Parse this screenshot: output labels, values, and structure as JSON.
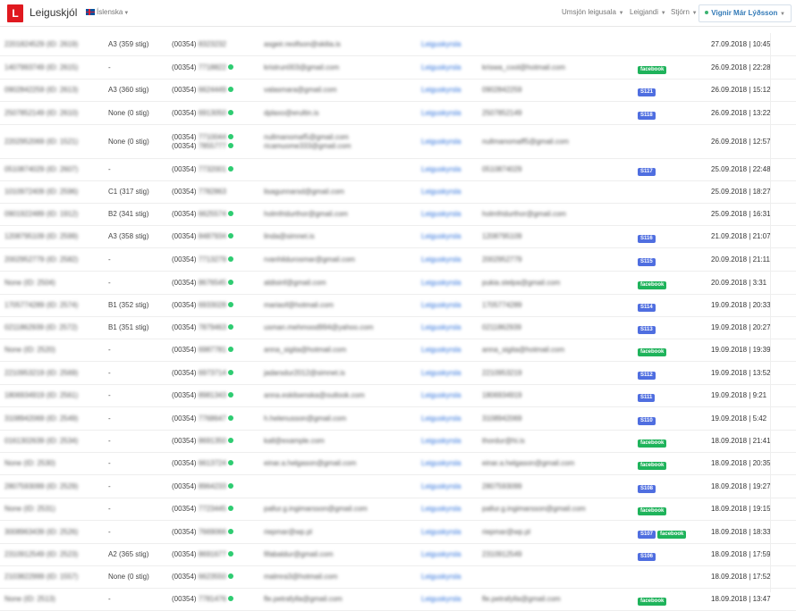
{
  "navbar": {
    "logo_letter": "L",
    "brand": "Leiguskjól",
    "language": "Íslenska",
    "menu": [
      "Umsjón leigusala",
      "Leigjandi",
      "Stjórn"
    ],
    "user": "Vignir Már Lýðsson"
  },
  "table": {
    "rows": [
      {
        "id": "2201824529 (ID: 2619)",
        "score": "A3 (359 stig)",
        "phone_prefix": "(00354)",
        "phone": "8323232",
        "verified": false,
        "email": "asgeir.reolfson@skilia.is",
        "link": "Leiguskyrsla",
        "extra": "",
        "badges": [],
        "date": "27.09.2018 | 10:45",
        "h": 25
      },
      {
        "id": "1407993749 (ID: 2615)",
        "score": "-",
        "phone_prefix": "(00354)",
        "phone": "7718822",
        "verified": true,
        "email": "kristrun003@gmail.com",
        "link": "Leiguskyrsla",
        "extra": "kriswa_cool@hotmail.com",
        "badges": [
          "facebook"
        ],
        "date": "26.09.2018 | 22:28",
        "h": 25
      },
      {
        "id": "0902842259 (ID: 2613)",
        "score": "A3 (360 stig)",
        "phone_prefix": "(00354)",
        "phone": "6624449",
        "verified": true,
        "email": "valasmara@gmail.com",
        "link": "Leiguskyrsla",
        "extra": "0902842259",
        "badges": [
          "S121"
        ],
        "date": "26.09.2018 | 15:12",
        "h": 24
      },
      {
        "id": "2507852149 (ID: 2610)",
        "score": "None (0 stig)",
        "phone_prefix": "(00354)",
        "phone": "6913050",
        "verified": true,
        "email": "dplaxo@erultin.is",
        "link": "Leiguskyrsla",
        "extra": "2507852149",
        "badges": [
          "S118"
        ],
        "date": "26.09.2018 | 13:22",
        "h": 25
      },
      {
        "id": "2202952069 (ID: 1521)",
        "score": "None (0 stig)",
        "phone_prefix": "(00354)",
        "phone": "7710044",
        "phone2": "7855777",
        "verified": true,
        "email": "nullmanomaf5@gmail.com",
        "email2": "ricamuome333@gmail.com",
        "link": "Leiguskyrsla",
        "extra": "nullmanomaff5@gmail.com",
        "badges": [],
        "date": "26.09.2018 | 12:57",
        "h": 37
      },
      {
        "id": "0510874029 (ID: 2607)",
        "score": "-",
        "phone_prefix": "(00354)",
        "phone": "7732001",
        "verified": true,
        "email": "",
        "link": "Leiguskyrsla",
        "extra": "0510874029",
        "badges": [
          "S117"
        ],
        "date": "25.09.2018 | 22:48",
        "h": 24
      },
      {
        "id": "1010972409 (ID: 2596)",
        "score": "C1 (317 stig)",
        "phone_prefix": "(00354)",
        "phone": "7782863",
        "verified": false,
        "email": "lisagunnarsd@gmail.com",
        "link": "Leiguskyrsla",
        "extra": "",
        "badges": [],
        "date": "25.09.2018 | 18:27",
        "h": 24
      },
      {
        "id": "0901922489 (ID: 1912)",
        "score": "B2 (341 stig)",
        "phone_prefix": "(00354)",
        "phone": "6625574",
        "verified": true,
        "email": "holmfridurthor@gmail.com",
        "link": "Leiguskyrsla",
        "extra": "holmfridurthor@gmail.com",
        "badges": [],
        "date": "25.09.2018 | 16:31",
        "h": 24
      },
      {
        "id": "1208795109 (ID: 2599)",
        "score": "A3 (358 stig)",
        "phone_prefix": "(00354)",
        "phone": "8487934",
        "verified": true,
        "email": "linda@simnet.is",
        "link": "Leiguskyrsla",
        "extra": "1208795109",
        "badges": [
          "S116"
        ],
        "date": "21.09.2018 | 21:07",
        "h": 24
      },
      {
        "id": "2002952779 (ID: 2582)",
        "score": "-",
        "phone_prefix": "(00354)",
        "phone": "7713279",
        "verified": true,
        "email": "rvanhildurosmar@gmail.com",
        "link": "Leiguskyrsla",
        "extra": "2002952779",
        "badges": [
          "S115"
        ],
        "date": "20.09.2018 | 21:11",
        "h": 25
      },
      {
        "id": "None (ID: 2504)",
        "score": "-",
        "phone_prefix": "(00354)",
        "phone": "8676545",
        "verified": true,
        "email": "aldisinf@gmail.com",
        "link": "Leiguskyrsla",
        "extra": "pukia.stelpa@gmail.com",
        "badges": [
          "facebook"
        ],
        "date": "20.09.2018 | 3:31",
        "h": 25
      },
      {
        "id": "1705774289 (ID: 2574)",
        "score": "B1 (352 stig)",
        "phone_prefix": "(00354)",
        "phone": "6933028",
        "verified": true,
        "email": "mariaof@hotmail.com",
        "link": "Leiguskyrsla",
        "extra": "1705774289",
        "badges": [
          "S114"
        ],
        "date": "19.09.2018 | 20:33",
        "h": 24
      },
      {
        "id": "0211862939 (ID: 2572)",
        "score": "B1 (351 stig)",
        "phone_prefix": "(00354)",
        "phone": "7879463",
        "verified": true,
        "email": "usman.mehmood994@yahoo.com",
        "link": "Leiguskyrsla",
        "extra": "0211862939",
        "badges": [
          "S113"
        ],
        "date": "19.09.2018 | 20:27",
        "h": 24
      },
      {
        "id": "None (ID: 2520)",
        "score": "-",
        "phone_prefix": "(00354)",
        "phone": "6987781",
        "verified": true,
        "email": "anna_sigita@hotmail.com",
        "link": "Leiguskyrsla",
        "extra": "anna_sigita@hotmail.com",
        "badges": [
          "facebook"
        ],
        "date": "19.09.2018 | 19:39",
        "h": 24
      },
      {
        "id": "2210953219 (ID: 2569)",
        "score": "-",
        "phone_prefix": "(00354)",
        "phone": "6973714",
        "verified": true,
        "email": "jadarsdur2012@simnet.is",
        "link": "Leiguskyrsla",
        "extra": "2210953219",
        "badges": [
          "S112"
        ],
        "date": "19.09.2018 | 13:52",
        "h": 25
      },
      {
        "id": "1806934919 (ID: 2561)",
        "score": "-",
        "phone_prefix": "(00354)",
        "phone": "8981343",
        "verified": true,
        "email": "anna.eskilsenska@outlook.com",
        "link": "Leiguskyrsla",
        "extra": "1806934919",
        "badges": [
          "S111"
        ],
        "date": "19.09.2018 | 9:21",
        "h": 24
      },
      {
        "id": "3108942069 (ID: 2549)",
        "score": "-",
        "phone_prefix": "(00354)",
        "phone": "7768647",
        "verified": true,
        "email": "h.helenusson@gmail.com",
        "link": "Leiguskyrsla",
        "extra": "3108942069",
        "badges": [
          "S110"
        ],
        "date": "19.09.2018 | 5:42",
        "h": 25
      },
      {
        "id": "0161302639 (ID: 2534)",
        "score": "-",
        "phone_prefix": "(00354)",
        "phone": "8691350",
        "verified": true,
        "email": "kall@example.com",
        "link": "Leiguskyrsla",
        "extra": "thordur@hi.is",
        "badges": [
          "facebook"
        ],
        "date": "18.09.2018 | 21:41",
        "h": 24
      },
      {
        "id": "None (ID: 2530)",
        "score": "-",
        "phone_prefix": "(00354)",
        "phone": "6613724",
        "verified": true,
        "email": "einar.a.helgason@gmail.com",
        "link": "Leiguskyrsla",
        "extra": "einar.a.helgason@gmail.com",
        "badges": [
          "facebook"
        ],
        "date": "18.09.2018 | 20:35",
        "h": 24
      },
      {
        "id": "2807593099 (ID: 2529)",
        "score": "-",
        "phone_prefix": "(00354)",
        "phone": "8964233",
        "verified": true,
        "email": "",
        "link": "Leiguskyrsla",
        "extra": "2807593099",
        "badges": [
          "S108"
        ],
        "date": "18.09.2018 | 19:27",
        "h": 25
      },
      {
        "id": "None (ID: 2531)",
        "score": "-",
        "phone_prefix": "(00354)",
        "phone": "7723445",
        "verified": true,
        "email": "pallur.g.ingimarsson@gmail.com",
        "link": "Leiguskyrsla",
        "extra": "pallur.g.ingimarsson@gmail.com",
        "badges": [
          "facebook"
        ],
        "date": "18.09.2018 | 19:15",
        "h": 24
      },
      {
        "id": "3008963439 (ID: 2526)",
        "score": "-",
        "phone_prefix": "(00354)",
        "phone": "7669066",
        "verified": true,
        "email": "riepmar@wp.pl",
        "link": "Leiguskyrsla",
        "extra": "riepmar@wp.pl",
        "badges": [
          "S107",
          "facebook"
        ],
        "date": "18.09.2018 | 18:33",
        "h": 25
      },
      {
        "id": "2310912549 (ID: 2523)",
        "score": "A2 (365 stig)",
        "phone_prefix": "(00354)",
        "phone": "8691677",
        "verified": true,
        "email": "fifabaldur@gmail.com",
        "link": "Leiguskyrsla",
        "extra": "2310912549",
        "badges": [
          "S106"
        ],
        "date": "18.09.2018 | 17:59",
        "h": 24
      },
      {
        "id": "2103822999 (ID: 1557)",
        "score": "None (0 stig)",
        "phone_prefix": "(00354)",
        "phone": "6623550",
        "verified": true,
        "email": "malmra3@hotmail.com",
        "link": "Leiguskyrsla",
        "extra": "",
        "badges": [],
        "date": "18.09.2018 | 17:52",
        "h": 24
      },
      {
        "id": "None (ID: 2513)",
        "score": "-",
        "phone_prefix": "(00354)",
        "phone": "7781476",
        "verified": true,
        "email": "fle.petrafylla@gmail.com",
        "link": "Leiguskyrsla",
        "extra": "fle.petrafylla@gmail.com",
        "badges": [
          "facebook"
        ],
        "date": "18.09.2018 | 13:47",
        "h": 24
      }
    ]
  },
  "colors": {
    "logo_red": "#e0191f",
    "link_blue": "#2a6fdb",
    "facebook_badge": "#1fb35b",
    "s_badge": "#4f6ee0",
    "verified_green": "#2ecc71"
  }
}
